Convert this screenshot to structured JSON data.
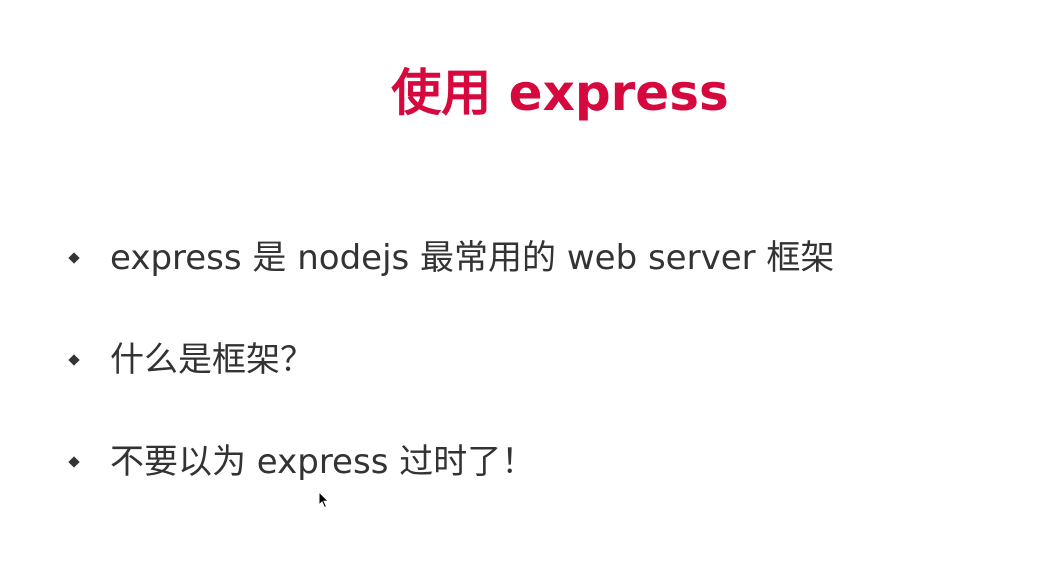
{
  "slide": {
    "title": "使用 express",
    "bullets": [
      {
        "text": "express 是 nodejs 最常用的 web server 框架"
      },
      {
        "text": "什么是框架？"
      },
      {
        "text": "不要以为 express 过时了！"
      }
    ]
  },
  "colors": {
    "title": "#d6093f",
    "text": "#333333",
    "bullet": "#333333",
    "background": "#ffffff"
  },
  "icons": {
    "bullet": "diamond-bullet-icon",
    "cursor": "mouse-pointer-icon"
  }
}
